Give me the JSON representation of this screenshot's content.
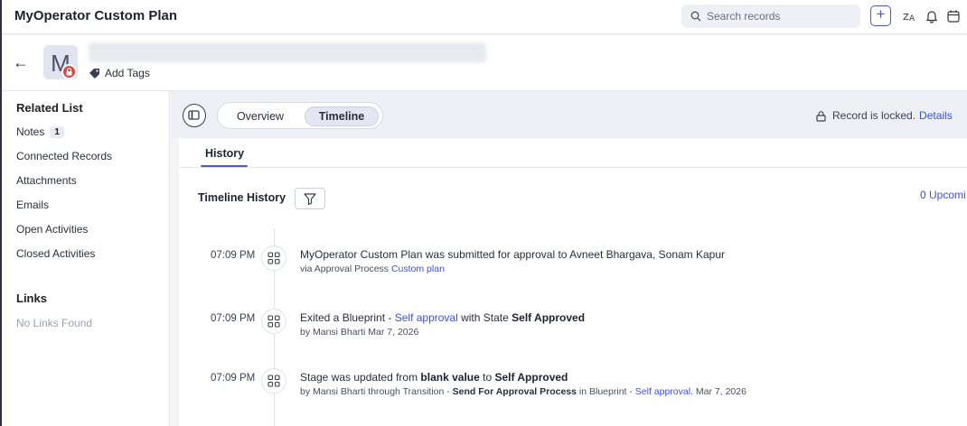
{
  "header": {
    "app_title": "MyOperator Custom Plan",
    "search_placeholder": "Search records",
    "plus_label": "+"
  },
  "record": {
    "avatar_letter": "M",
    "add_tags_label": "Add Tags"
  },
  "sidebar": {
    "related_list_title": "Related List",
    "items": [
      {
        "label": "Notes",
        "count": "1"
      },
      {
        "label": "Connected Records"
      },
      {
        "label": "Attachments"
      },
      {
        "label": "Emails"
      },
      {
        "label": "Open Activities"
      },
      {
        "label": "Closed Activities"
      }
    ],
    "links_title": "Links",
    "no_links_text": "No Links Found"
  },
  "toolbar": {
    "tabs": [
      {
        "label": "Overview",
        "active": false
      },
      {
        "label": "Timeline",
        "active": true
      }
    ],
    "locked_text": "Record is locked.",
    "details_label": "Details"
  },
  "panel": {
    "subtab_label": "History",
    "timeline_title": "Timeline History",
    "upcoming_label": "0 Upcomi"
  },
  "timeline": [
    {
      "time": "07:09 PM",
      "line1": [
        {
          "t": "MyOperator Custom Plan was submitted for approval to Avneet Bhargava, Sonam Kapur",
          "s": "n"
        }
      ],
      "line2": [
        {
          "t": "via Approval Process ",
          "s": "n"
        },
        {
          "t": "Custom plan",
          "s": "l"
        }
      ]
    },
    {
      "time": "07:09 PM",
      "line1": [
        {
          "t": "Exited a Blueprint - ",
          "s": "n"
        },
        {
          "t": "Self approval",
          "s": "l"
        },
        {
          "t": " with State ",
          "s": "n"
        },
        {
          "t": "Self Approved",
          "s": "b"
        }
      ],
      "line2": [
        {
          "t": "by Mansi Bharti Mar 7, 2026",
          "s": "n"
        }
      ]
    },
    {
      "time": "07:09 PM",
      "line1": [
        {
          "t": "Stage was updated from ",
          "s": "n"
        },
        {
          "t": "blank value",
          "s": "b"
        },
        {
          "t": " to ",
          "s": "n"
        },
        {
          "t": "Self Approved",
          "s": "b"
        }
      ],
      "line2": [
        {
          "t": "by Mansi Bharti through Transition - ",
          "s": "n"
        },
        {
          "t": "Send For Approval Process",
          "s": "bk"
        },
        {
          "t": " in Blueprint - ",
          "s": "n"
        },
        {
          "t": "Self approval",
          "s": "l"
        },
        {
          "t": ". Mar 7, 2026",
          "s": "n"
        }
      ]
    }
  ],
  "colors": {
    "accent": "#4b55d6",
    "link": "#3d52d5",
    "lock_badge": "#e0463e"
  }
}
